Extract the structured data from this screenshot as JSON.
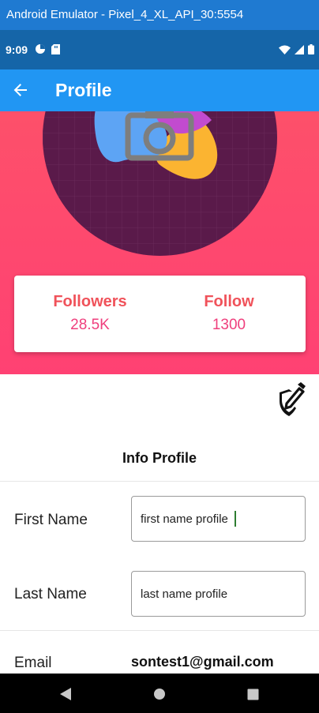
{
  "window": {
    "title": "Android Emulator - Pixel_4_XL_API_30:5554"
  },
  "status_bar": {
    "time": "9:09",
    "icons": [
      "data-saver-icon",
      "sd-card-icon",
      "wifi-icon",
      "signal-icon",
      "battery-icon"
    ]
  },
  "app_bar": {
    "title": "Profile",
    "back_icon": "arrow-back-icon"
  },
  "header": {
    "avatar_icon": "camera-icon",
    "colors": {
      "gradient_top": "#fd506a",
      "gradient_bottom": "#ff4173",
      "avatar_bg": "#5a1a4a"
    }
  },
  "stats": {
    "followers_label": "Followers",
    "followers_value": "28.5K",
    "follow_label": "Follow",
    "follow_value": "1300",
    "colors": {
      "label": "#f0525a",
      "value": "#ef3f7d"
    }
  },
  "edit_icon": "edit-shield-icon",
  "info": {
    "title": "Info Profile",
    "first_name_label": "First Name",
    "first_name_value": "first name profile",
    "last_name_label": "Last Name",
    "last_name_value": "last name profile",
    "email_label": "Email",
    "email_value": "sontest1@gmail.com"
  },
  "nav_bar": {
    "buttons": [
      "back-triangle-icon",
      "home-circle-icon",
      "recents-square-icon"
    ]
  }
}
